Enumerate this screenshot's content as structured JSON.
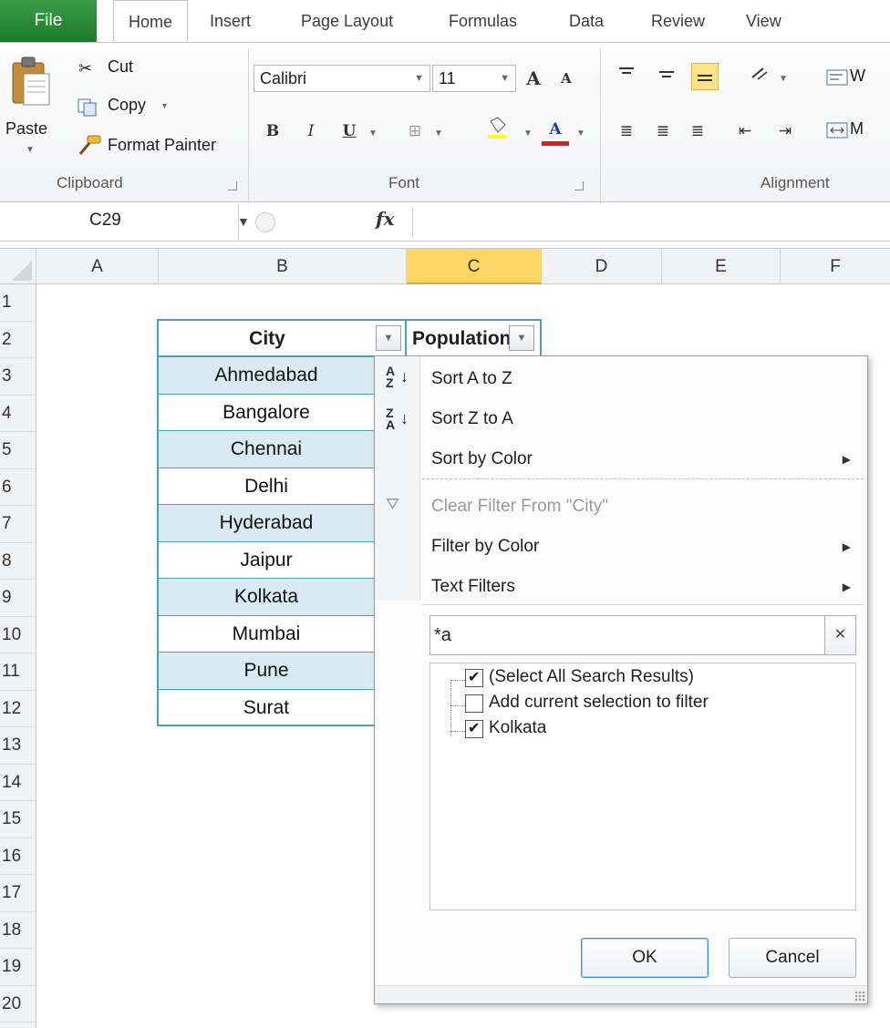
{
  "tabs": [
    "File",
    "Home",
    "Insert",
    "Page Layout",
    "Formulas",
    "Data",
    "Review",
    "View"
  ],
  "ribbon": {
    "clipboard": {
      "paste": "Paste",
      "cut": "Cut",
      "copy": "Copy",
      "format_painter": "Format Painter",
      "label": "Clipboard"
    },
    "font": {
      "name": "Calibri",
      "size": "11",
      "bold": "B",
      "italic": "I",
      "underline": "U",
      "grow": "A",
      "shrink": "A",
      "font_color_letter": "A",
      "label": "Font"
    },
    "alignment": {
      "label": "Alignment",
      "wrap_truncated": "W",
      "merge_truncated": "M"
    }
  },
  "formula_bar": {
    "name_box": "C29",
    "fx": "fx"
  },
  "columns": [
    "A",
    "B",
    "C",
    "D",
    "E",
    "F"
  ],
  "rows": [
    "1",
    "2",
    "3",
    "4",
    "5",
    "6",
    "7",
    "8",
    "9",
    "10",
    "11",
    "12",
    "13",
    "14",
    "15",
    "16",
    "17",
    "18",
    "19",
    "20"
  ],
  "table": {
    "headers": {
      "city": "City",
      "population": "Population"
    },
    "cities": [
      "Ahmedabad",
      "Bangalore",
      "Chennai",
      "Delhi",
      "Hyderabad",
      "Jaipur",
      "Kolkata",
      "Mumbai",
      "Pune",
      "Surat"
    ]
  },
  "filter_menu": {
    "sort_az": "Sort A to Z",
    "sort_za": "Sort Z to A",
    "sort_by_color": "Sort by Color",
    "clear_filter": "Clear Filter From \"City\"",
    "filter_by_color": "Filter by Color",
    "text_filters": "Text Filters",
    "search_value": "*a",
    "list": [
      {
        "label": "(Select All Search Results)",
        "checked": true
      },
      {
        "label": "Add current selection to filter",
        "checked": false
      },
      {
        "label": "Kolkata",
        "checked": true
      }
    ],
    "ok": "OK",
    "cancel": "Cancel"
  },
  "colors": {
    "file_tab": "#2b8a3a",
    "table_border": "#4aa0ba",
    "band_fill": "#d9eaf2",
    "selected_col_header": "#ffd765"
  }
}
